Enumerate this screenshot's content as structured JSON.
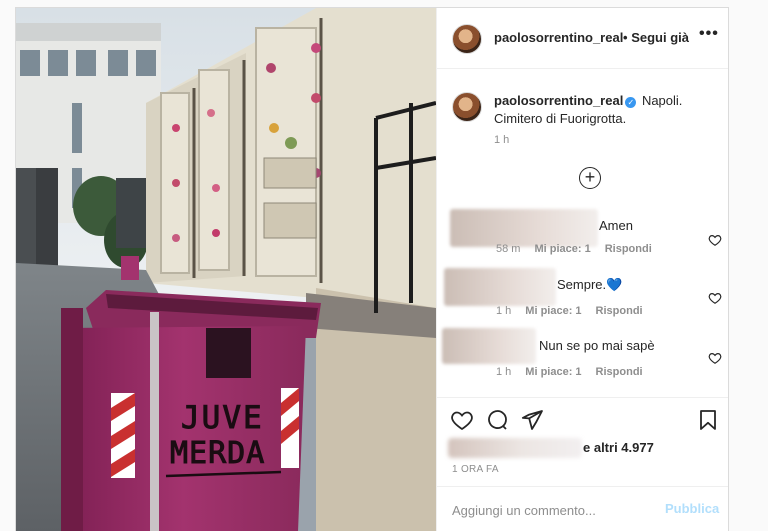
{
  "header": {
    "username": "paolosorrentino_real",
    "separator": "•",
    "follow_label": "Segui già",
    "more_icon": "more-horizontal-icon"
  },
  "caption": {
    "username": "paolosorrentino_real",
    "text": "Napoli. Cimitero di Fuorigrotta.",
    "time": "1 h",
    "load_more_icon": "plus-circle-icon"
  },
  "photo": {
    "graffiti_line1": "JUVE",
    "graffiti_line2": "MERDA"
  },
  "comments": [
    {
      "text": "Amen",
      "time": "58 m",
      "likes": "Mi piace: 1",
      "reply": "Rispondi"
    },
    {
      "text": "Sempre.💙",
      "time": "1 h",
      "likes": "Mi piace: 1",
      "reply": "Rispondi"
    },
    {
      "text": "Nun se po mai sapè",
      "time": "1 h",
      "likes": "Mi piace: 1",
      "reply": "Rispondi"
    }
  ],
  "actions": {
    "like_icon": "heart-icon",
    "comment_icon": "comment-bubble-icon",
    "share_icon": "paper-plane-icon",
    "save_icon": "bookmark-icon",
    "likes_suffix": "e altri 4.977",
    "date": "1 ORA FA"
  },
  "add_comment": {
    "placeholder": "Aggiungi un commento...",
    "publish_label": "Pubblica"
  },
  "colors": {
    "link_disabled": "#b2dffc",
    "verified": "#3897f0",
    "secondary_text": "#8e8e8e",
    "bin_magenta": "#a3336e"
  }
}
